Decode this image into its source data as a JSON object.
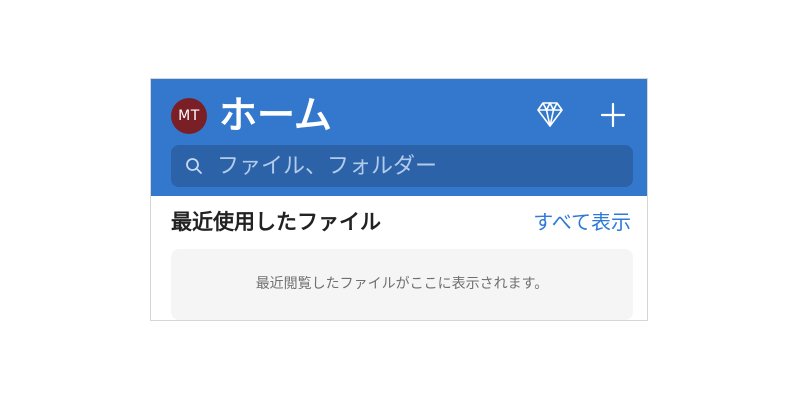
{
  "header": {
    "avatar_initials": "MT",
    "title": "ホーム",
    "premium_icon": "diamond-icon",
    "add_icon": "plus-icon"
  },
  "search": {
    "placeholder": "ファイル、フォルダー",
    "value": "",
    "icon": "search-icon"
  },
  "recent": {
    "title": "最近使用したファイル",
    "see_all_label": "すべて表示",
    "empty_message": "最近閲覧したファイルがここに表示されます。"
  },
  "colors": {
    "header_bg": "#3378cc",
    "search_bg": "#2b62a8",
    "avatar_bg": "#7a1f25",
    "link": "#2f7ad8",
    "card_bg": "#f5f5f5"
  }
}
